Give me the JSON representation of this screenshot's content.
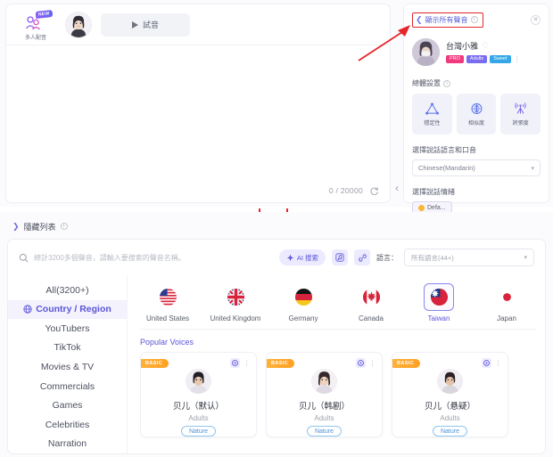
{
  "editor": {
    "multi_dub_label": "多人配音",
    "multi_dub_badge": "NEW",
    "audition_label": "試音",
    "char_count": "0 / 20000"
  },
  "voice_panel": {
    "show_all_label": "顯示所有聲音",
    "voice_name": "台灣小雅",
    "tags": [
      {
        "label": "PRO",
        "color": "#f0387d"
      },
      {
        "label": "Adults",
        "color": "#7a6cf0"
      },
      {
        "label": "Sweet",
        "color": "#35a7e8"
      }
    ],
    "attributes_label": "總體設置",
    "attributes": [
      {
        "name": "穩定性",
        "icon": "triangle-icon"
      },
      {
        "name": "相似度",
        "icon": "similarity-icon"
      },
      {
        "name": "誇張度",
        "icon": "antenna-icon"
      }
    ],
    "language_label": "選擇說話語言和口音",
    "language_value": "Chinese(Mandarin)",
    "emotion_label": "選擇說話情緒",
    "emotion_value": "Defa..."
  },
  "library": {
    "hide_list_label": "隱藏列表",
    "search_placeholder": "總計3200多個聲音，請輸入要搜索的聲音名稱。",
    "search_value": "",
    "ai_search_label": "AI 搜索",
    "language_filter_label": "語言：",
    "language_filter_value": "所有語言(44+)",
    "categories": [
      {
        "label": "All(3200+)",
        "active": false,
        "icon": ""
      },
      {
        "label": "Country / Region",
        "active": true,
        "icon": "globe-icon"
      },
      {
        "label": "YouTubers",
        "active": false,
        "icon": ""
      },
      {
        "label": "TikTok",
        "active": false,
        "icon": ""
      },
      {
        "label": "Movies & TV",
        "active": false,
        "icon": ""
      },
      {
        "label": "Commercials",
        "active": false,
        "icon": ""
      },
      {
        "label": "Games",
        "active": false,
        "icon": ""
      },
      {
        "label": "Celebrities",
        "active": false,
        "icon": ""
      },
      {
        "label": "Narration",
        "active": false,
        "icon": ""
      }
    ],
    "countries": [
      {
        "name": "United States",
        "flag": "us-flag-icon",
        "active": false
      },
      {
        "name": "United Kingdom",
        "flag": "uk-flag-icon",
        "active": false
      },
      {
        "name": "Germany",
        "flag": "de-flag-icon",
        "active": false
      },
      {
        "name": "Canada",
        "flag": "ca-flag-icon",
        "active": false
      },
      {
        "name": "Taiwan",
        "flag": "tw-flag-icon",
        "active": true
      },
      {
        "name": "Japan",
        "flag": "jp-flag-icon",
        "active": false
      }
    ],
    "popular_title": "Popular Voices",
    "voice_cards": [
      {
        "ribbon": "BASIC",
        "name": "贝儿（默认）",
        "age": "Adults",
        "tag": "Nature"
      },
      {
        "ribbon": "BASIC",
        "name": "贝儿（韩剧）",
        "age": "Adults",
        "tag": "Nature"
      },
      {
        "ribbon": "BASIC",
        "name": "贝儿（悬疑）",
        "age": "Adults",
        "tag": "Nature"
      }
    ]
  },
  "annotations": {
    "arrow_color": "#e5262b",
    "highlight_box_color": "#e5262b"
  }
}
